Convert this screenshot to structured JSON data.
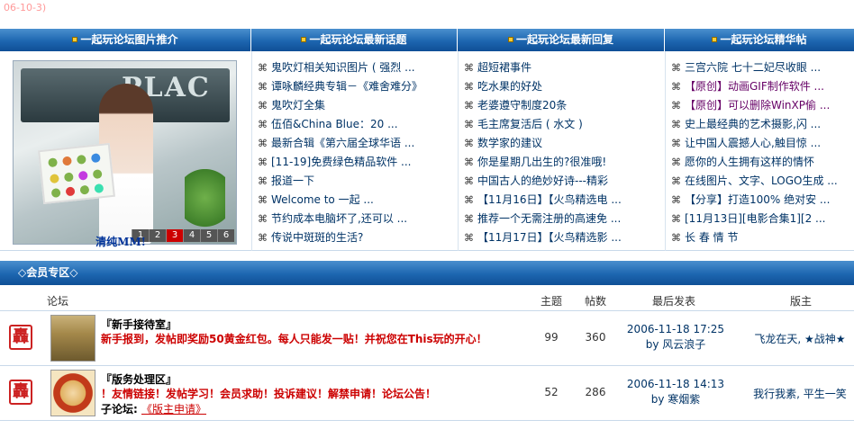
{
  "top_date": "06-10-3)",
  "columns": [
    {
      "header": "一起玩论坛图片推介"
    },
    {
      "header": "一起玩论坛最新话题"
    },
    {
      "header": "一起玩论坛最新回复"
    },
    {
      "header": "一起玩论坛精华帖"
    }
  ],
  "picture": {
    "screen_text": "PLAC",
    "numbers": [
      "1",
      "2",
      "3",
      "4",
      "5",
      "6"
    ],
    "active_number": "3",
    "caption": "清纯MM!"
  },
  "bullet": "⌘",
  "latest_topics": [
    "鬼吹灯相关知识图片 ( 强烈 ...",
    "谭咏麟经典专辑－《难舍难分》",
    "鬼吹灯全集",
    "伍佰&China Blue：20 ...",
    "最新合辑《第六届全球华语 ...",
    "[11-19]免费绿色精品软件 ...",
    "报道一下",
    "Welcome to 一起 ...",
    "节约成本电脑坏了,还可以 ...",
    "传说中斑斑的生活?"
  ],
  "latest_replies": [
    "超短裙事件",
    "吃水果的好处",
    "老婆遵守制度20条",
    "毛主席复活后 ( 水文 )",
    "数学家的建议",
    "你是星期几出生的?很准哦!",
    "中国古人的绝妙好诗---精彩",
    "【11月16日】【火鸟精选电 ...",
    "推荐一个无需注册的高速免 ...",
    "【11月17日】【火鸟精选影 ..."
  ],
  "essence_posts": [
    {
      "text": "三宫六院 七十二妃尽收眼 ...",
      "purple": false
    },
    {
      "text": "【原创】动画GIF制作软件 ...",
      "purple": true
    },
    {
      "text": "【原创】可以删除WinXP偷 ...",
      "purple": true
    },
    {
      "text": "史上最经典的艺术摄影,闪 ...",
      "purple": false
    },
    {
      "text": "让中国人震撼人心,触目惊 ...",
      "purple": false
    },
    {
      "text": "愿你的人生拥有这样的情怀",
      "purple": false
    },
    {
      "text": "在线图片、文字、LOGO生成 ...",
      "purple": false
    },
    {
      "text": "【分享】打造100% 绝对安 ...",
      "purple": false
    },
    {
      "text": "[11月13日][电影合集1][2 ...",
      "purple": false
    },
    {
      "text": "长 春 情 节",
      "purple": false
    }
  ],
  "member_zone": {
    "title": "◇会员专区◇",
    "headers": {
      "forum": "论坛",
      "topics": "主题",
      "posts": "帖数",
      "last_post": "最后发表",
      "moderator": "版主"
    },
    "forums": [
      {
        "seal": "轟",
        "name": "『新手接待室』",
        "desc": "新手报到，发帖即奖励50黄金红包。每人只能发一贴！并祝您在This玩的开心！",
        "sub_label": "",
        "sub_link": "",
        "topics": "99",
        "posts": "360",
        "last_time": "2006-11-18 17:25",
        "last_by": "by 风云浪子",
        "moderators": "飞龙在天, ★战神★"
      },
      {
        "seal": "轟",
        "name": "『版务处理区』",
        "desc": "！友情链接！发帖学习！会员求助！投诉建议！解禁申请！论坛公告！",
        "sub_label": "子论坛:",
        "sub_link": "《版主申请》",
        "topics": "52",
        "posts": "286",
        "last_time": "2006-11-18 14:13",
        "last_by": "by 寒烟紫",
        "moderators": "我行我素, 平生一笑"
      }
    ]
  }
}
